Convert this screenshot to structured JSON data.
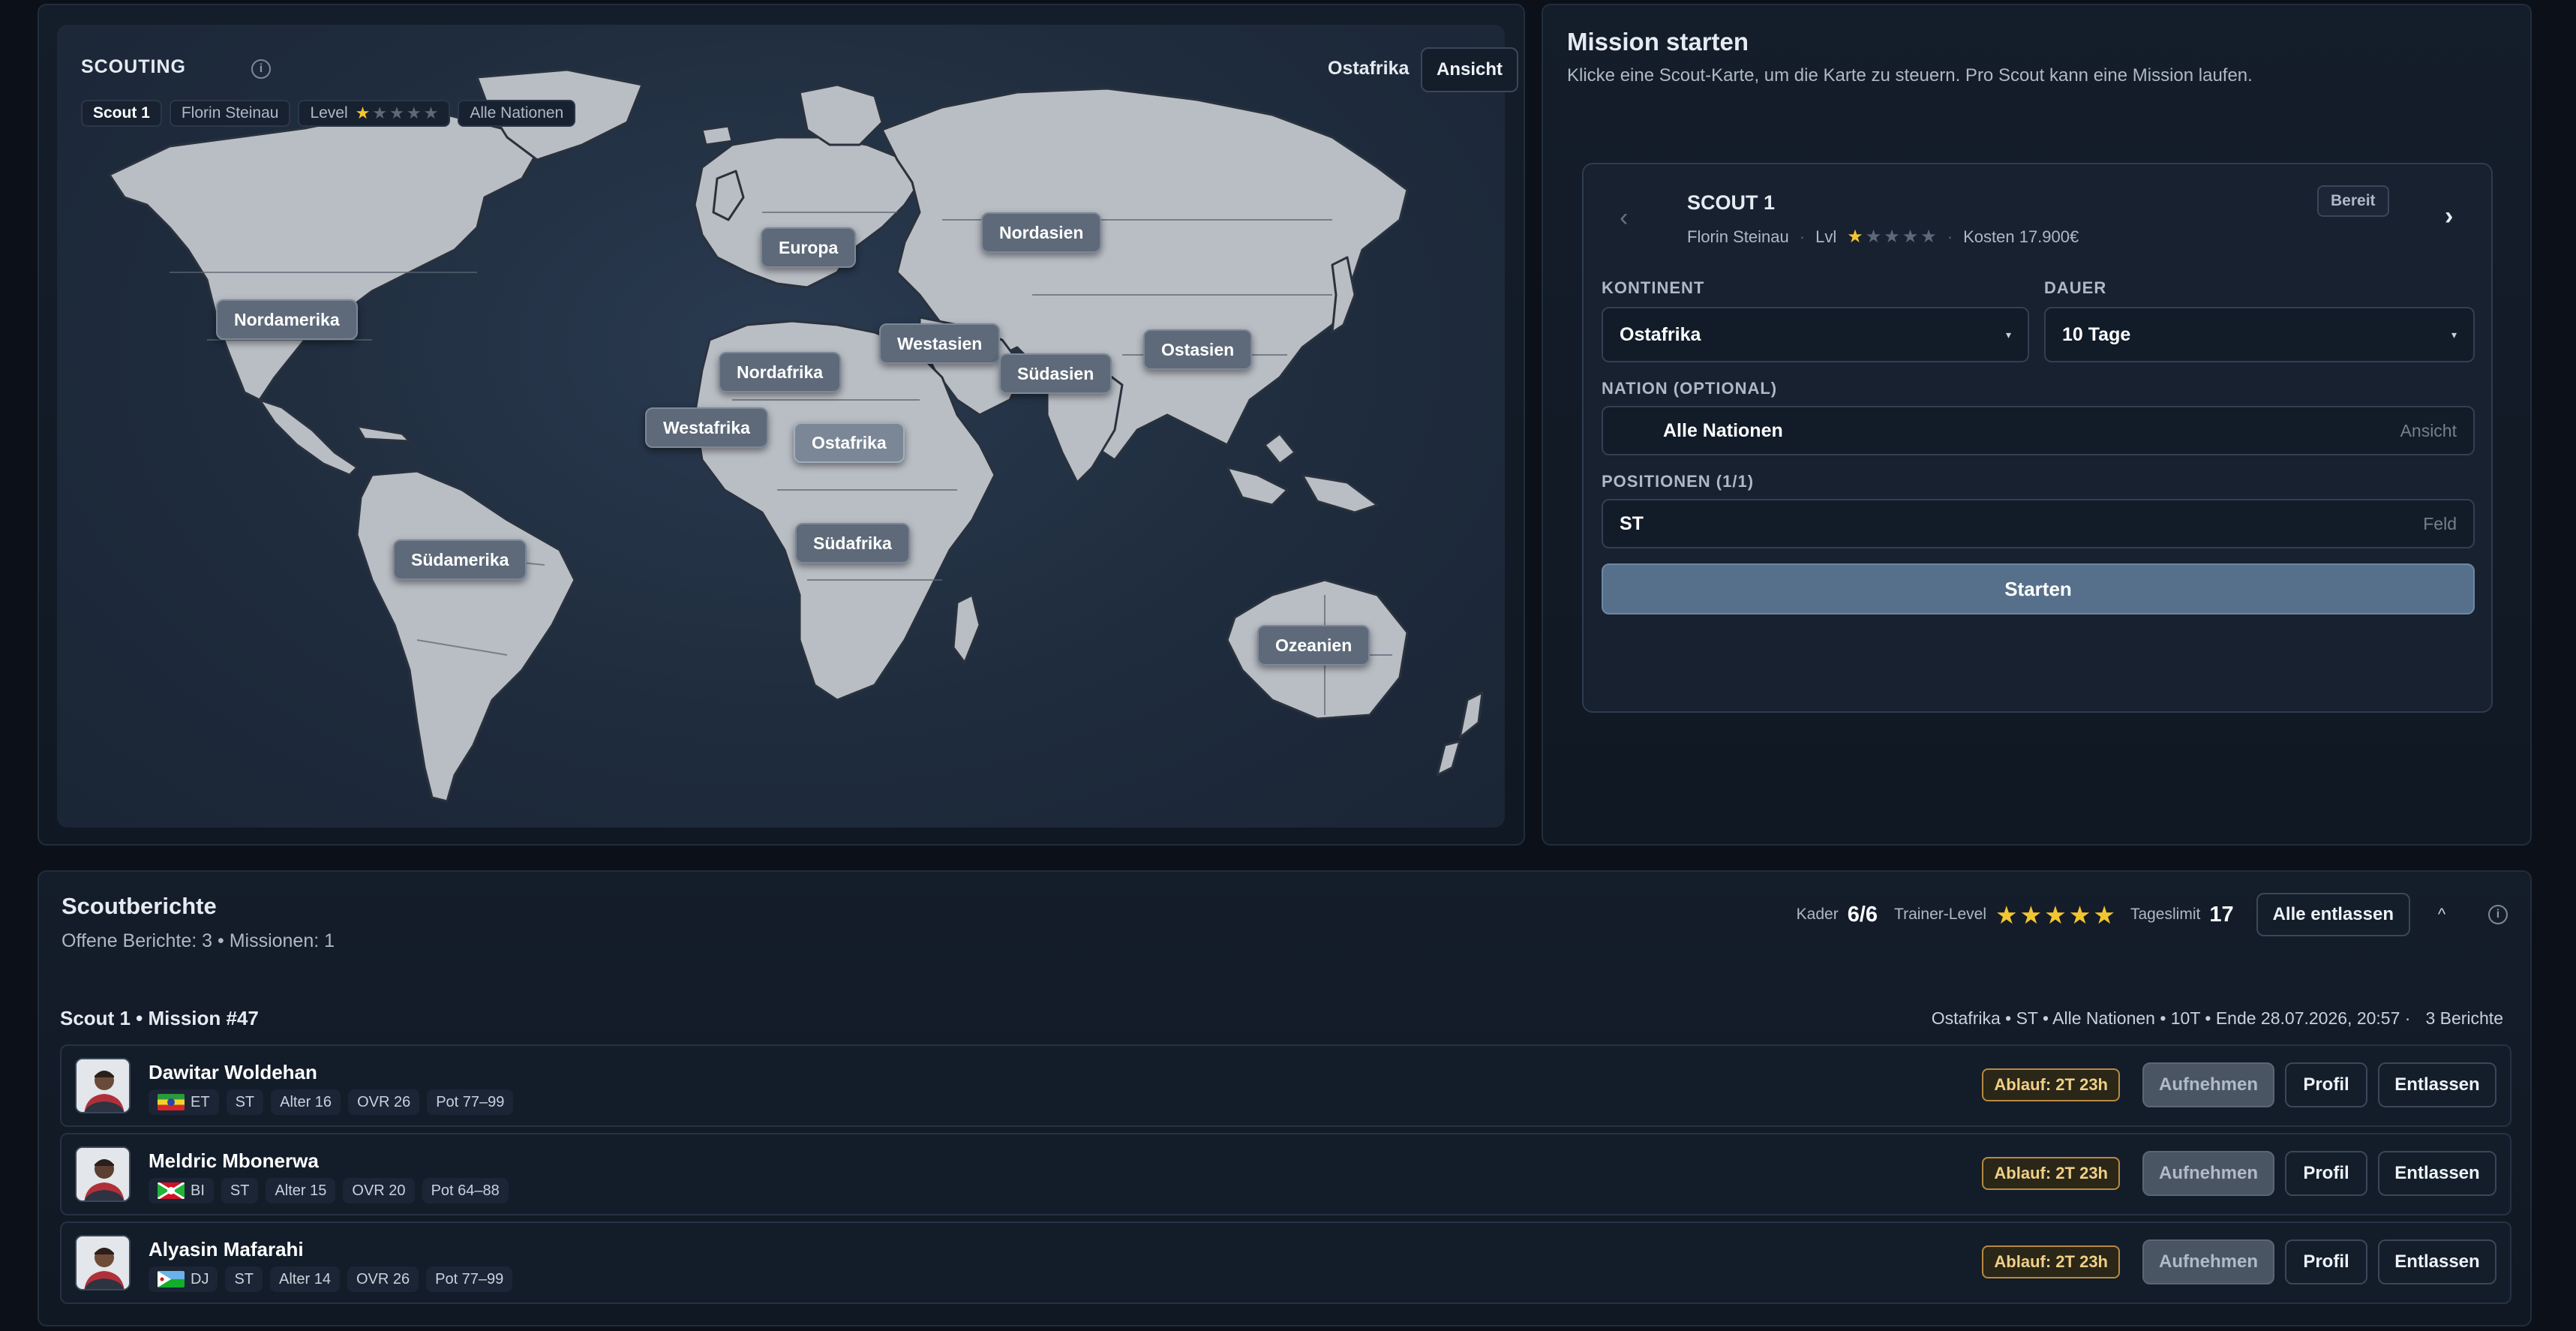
{
  "scouting": {
    "title": "SCOUTING",
    "info_icon": "i",
    "current_region": "Ostafrika",
    "view_button": "Ansicht",
    "filters": {
      "scout": "Scout 1",
      "name": "Florin Steinau",
      "level_label": "Level",
      "level_stars": 1,
      "nations": "Alle Nationen"
    },
    "regions": [
      "Nordamerika",
      "Europa",
      "Nordasien",
      "Westasien",
      "Nordafrika",
      "Südasien",
      "Ostasien",
      "Westafrika",
      "Ostafrika",
      "Südamerika",
      "Südafrika",
      "Ozeanien"
    ],
    "selected_region": "Ostafrika"
  },
  "mission": {
    "title": "Mission starten",
    "subtitle": "Klicke eine Scout-Karte, um die Karte zu steuern. Pro Scout kann eine Mission laufen.",
    "card": {
      "scout_name": "SCOUT 1",
      "person": "Florin Steinau",
      "level_label": "Lvl",
      "level_stars": 1,
      "cost": "Kosten 17.900€",
      "status": "Bereit",
      "prev_icon": "‹",
      "next_icon": "›"
    },
    "continent_label": "KONTINENT",
    "continent_value": "Ostafrika",
    "duration_label": "DAUER",
    "duration_value": "10 Tage",
    "nation_label": "NATION (OPTIONAL)",
    "nation_value": "Alle Nationen",
    "nation_hint": "Ansicht",
    "positions_label": "POSITIONEN (1/1)",
    "positions_value": "ST",
    "positions_hint": "Feld",
    "start_button": "Starten"
  },
  "reports": {
    "title": "Scoutberichte",
    "subtitle": "Offene Berichte: 3 • Missionen: 1",
    "kader_label": "Kader",
    "kader_value": "6/6",
    "trainer_label": "Trainer-Level",
    "trainer_stars": 5,
    "tageslimit_label": "Tageslimit",
    "tageslimit_value": "17",
    "dismiss_all": "Alle entlassen",
    "collapse_icon": "^",
    "info_icon": "i",
    "mission_header": "Scout 1 • Mission #47",
    "mission_info": "Ostafrika • ST • Alle Nationen • 10T • Ende 28.07.2026, 20:57 ·",
    "mission_count": "3 Berichte",
    "players": [
      {
        "name": "Dawitar Woldehan",
        "flag": "ET",
        "country": "ET",
        "position": "ST",
        "age": "Alter 16",
        "ovr": "OVR 26",
        "pot": "Pot 77–99",
        "expiry": "Ablauf: 2T 23h",
        "accept": "Aufnehmen",
        "profile": "Profil",
        "dismiss": "Entlassen"
      },
      {
        "name": "Meldric Mbonerwa",
        "flag": "BI",
        "country": "BI",
        "position": "ST",
        "age": "Alter 15",
        "ovr": "OVR 20",
        "pot": "Pot 64–88",
        "expiry": "Ablauf: 2T 23h",
        "accept": "Aufnehmen",
        "profile": "Profil",
        "dismiss": "Entlassen"
      },
      {
        "name": "Alyasin Mafarahi",
        "flag": "DJ",
        "country": "DJ",
        "position": "ST",
        "age": "Alter 14",
        "ovr": "OVR 26",
        "pot": "Pot 77–99",
        "expiry": "Ablauf: 2T 23h",
        "accept": "Aufnehmen",
        "profile": "Profil",
        "dismiss": "Entlassen"
      }
    ]
  },
  "colors": {
    "background": "#0c1119",
    "map_land": "#b9bec5",
    "region_label": "#5e6a79",
    "star_on": "#f3c530",
    "start_button": "#56708b",
    "expiry_border": "#b8893f"
  }
}
